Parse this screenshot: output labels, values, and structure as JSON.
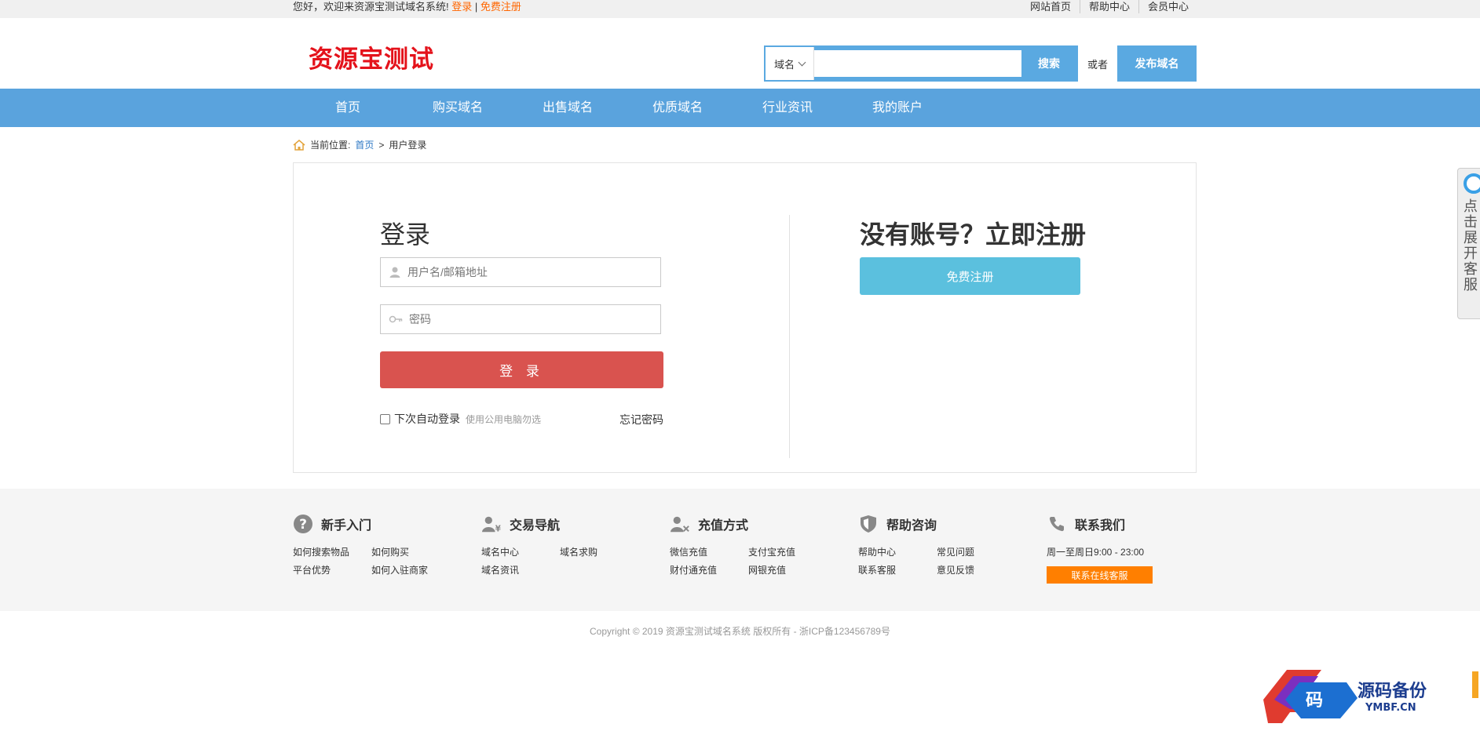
{
  "topbar": {
    "welcome": "您好，欢迎来资源宝测试域名系统!",
    "login": "登录",
    "sep": "|",
    "register": "免费注册",
    "links": [
      "网站首页",
      "帮助中心",
      "会员中心"
    ]
  },
  "header": {
    "logo": "资源宝测试",
    "search_type": "域名",
    "search_placeholder": "",
    "search_button": "搜索",
    "or": "或者",
    "publish_button": "发布域名"
  },
  "nav": {
    "items": [
      "首页",
      "购买域名",
      "出售域名",
      "优质域名",
      "行业资讯",
      "我的账户"
    ]
  },
  "breadcrumb": {
    "label": "当前位置:",
    "home": "首页",
    "arrow": ">",
    "current": "用户登录"
  },
  "login": {
    "title": "登录",
    "username_placeholder": "用户名/邮箱地址",
    "password_placeholder": "密码",
    "submit": "登 录",
    "remember": "下次自动登录",
    "remember_hint": "使用公用电脑勿选",
    "forgot": "忘记密码"
  },
  "register": {
    "title": "没有账号？立即注册",
    "button": "免费注册"
  },
  "footer": {
    "cols": [
      {
        "title": "新手入门",
        "icon": "question-icon",
        "links": [
          "如何搜索物品",
          "如何购买",
          "平台优势",
          "如何入驻商家"
        ]
      },
      {
        "title": "交易导航",
        "icon": "user-yen-icon",
        "links": [
          "域名中心",
          "域名求购",
          "域名资讯"
        ]
      },
      {
        "title": "充值方式",
        "icon": "user-card-icon",
        "links": [
          "微信充值",
          "支付宝充值",
          "财付通充值",
          "网银充值"
        ]
      },
      {
        "title": "帮助咨询",
        "icon": "shield-icon",
        "links": [
          "帮助中心",
          "常见问题",
          "联系客服",
          "意见反馈"
        ]
      }
    ],
    "contact": {
      "title": "联系我们",
      "hours": "周一至周日9:00 - 23:00",
      "button": "联系在线客服"
    },
    "copyright": "Copyright © 2019 资源宝测试域名系统 版权所有 - 浙ICP备123456789号"
  },
  "side_tab": {
    "label": "点击展开客服"
  },
  "watermark": {
    "glyph": "码",
    "name": "源码备份",
    "site": "YMBF.CN"
  },
  "colors": {
    "primary": "#5aa3dd",
    "login_button": "#d9534f",
    "register_button": "#5bc0de",
    "accent_orange": "#ff7f00",
    "logo_red": "#e4121b"
  }
}
